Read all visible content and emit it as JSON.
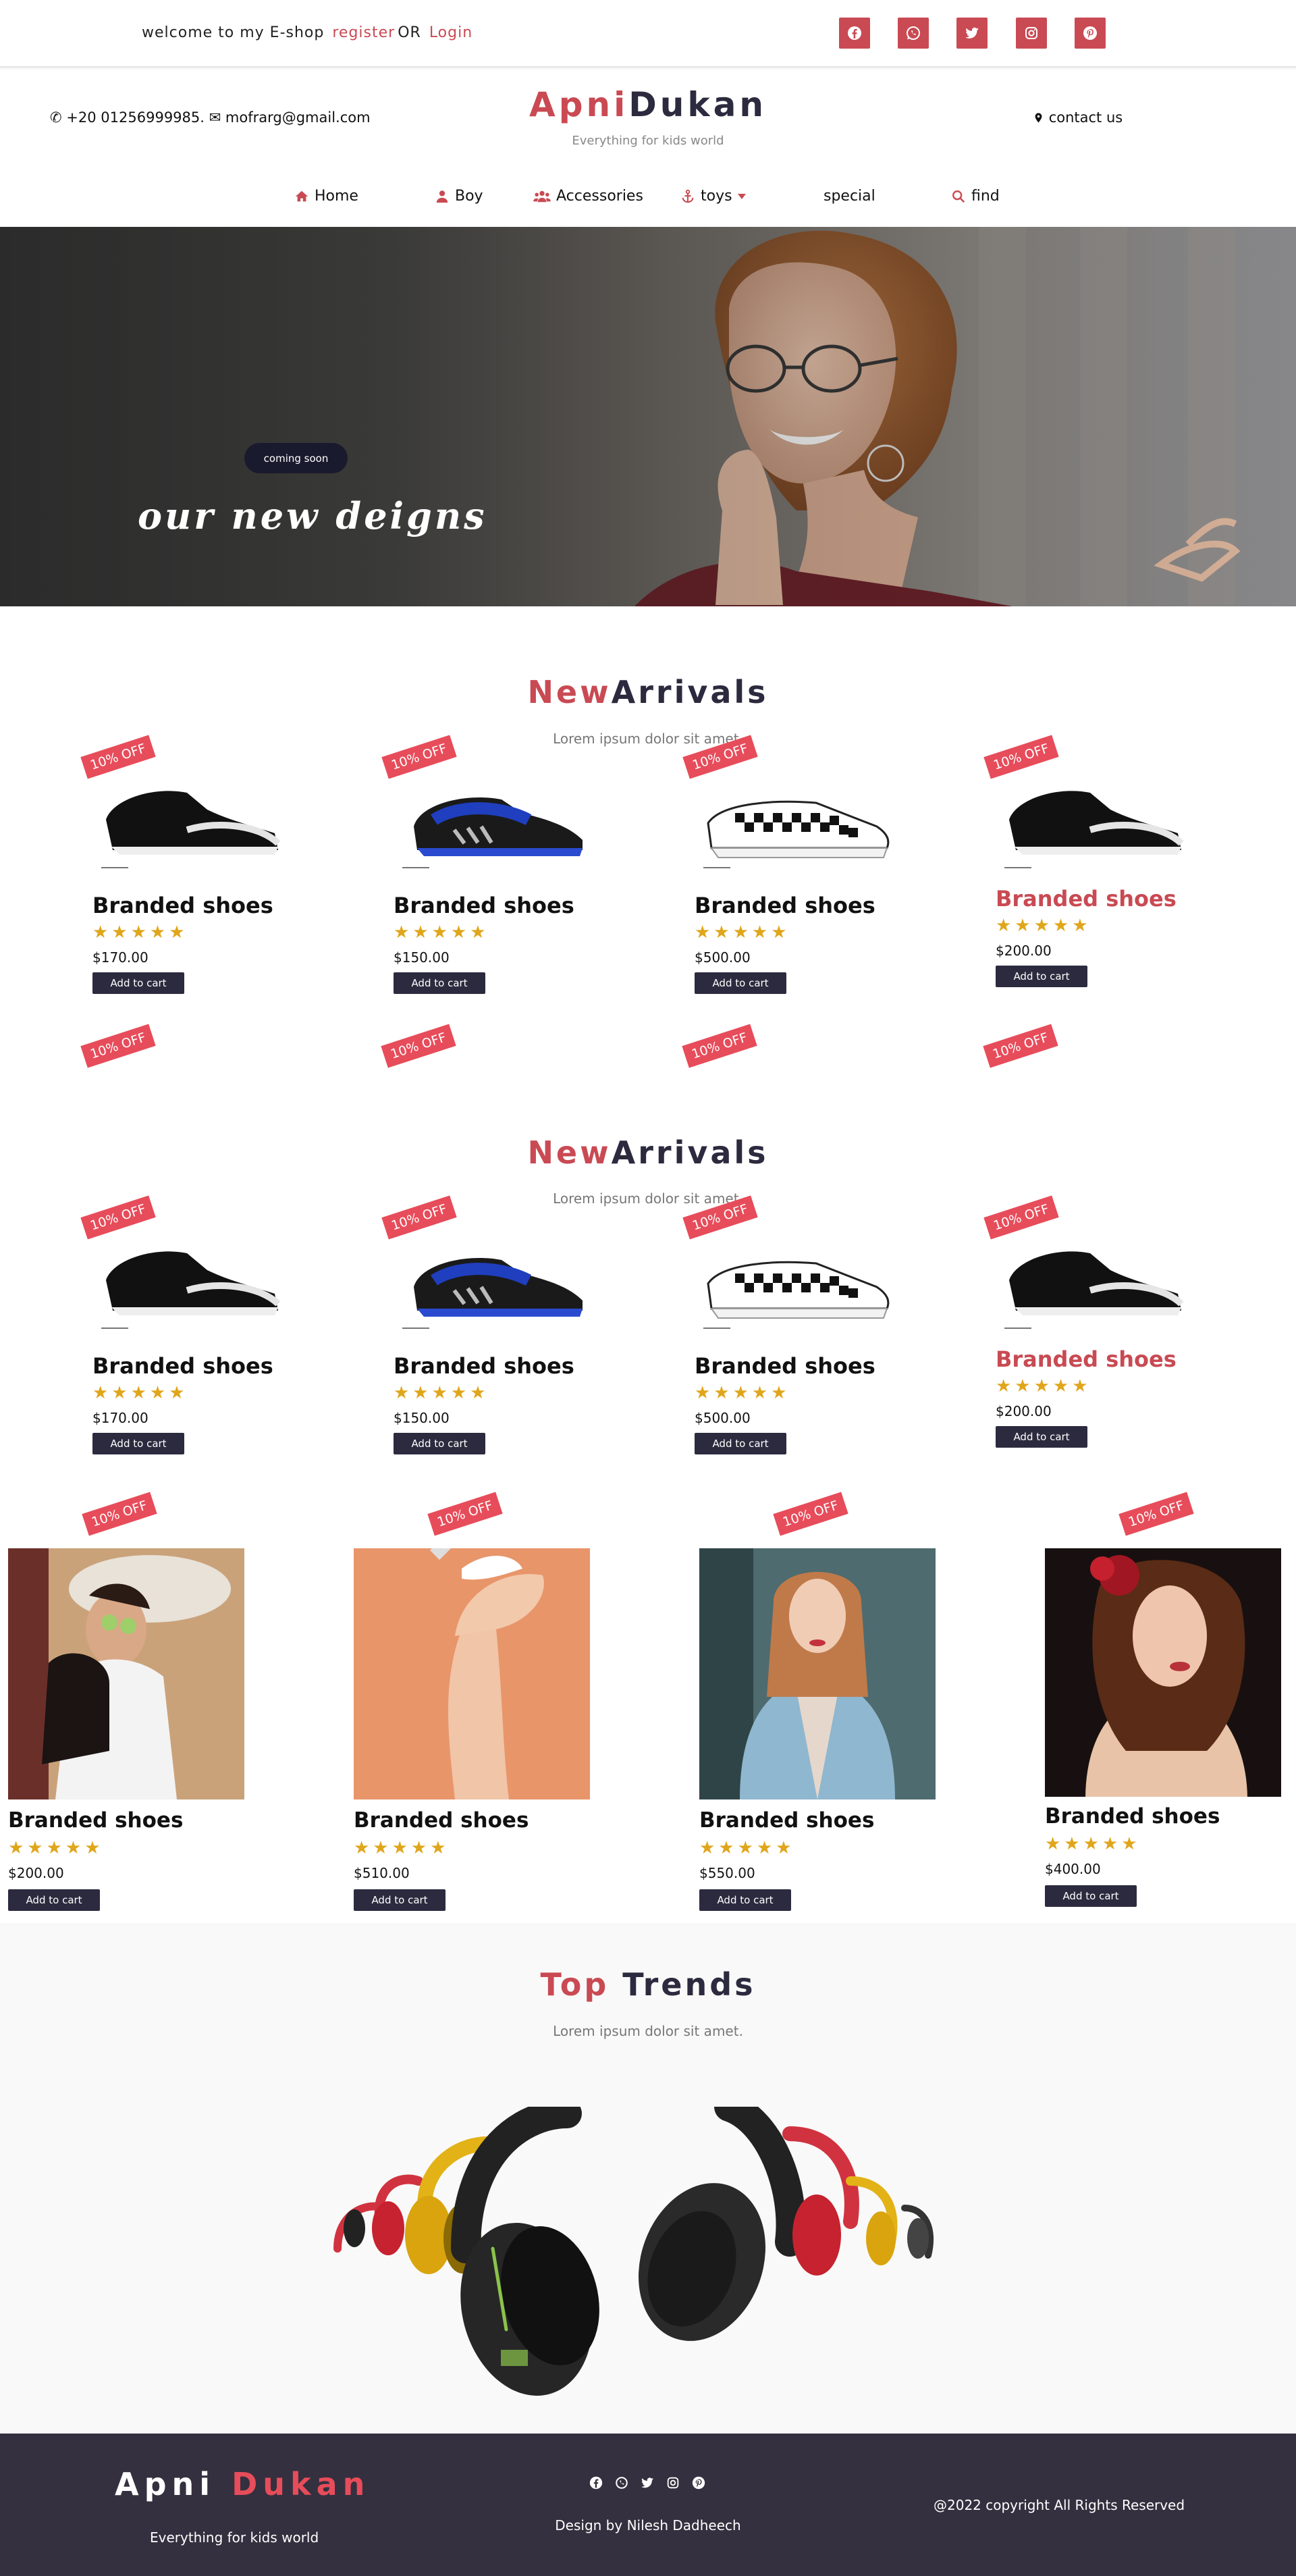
{
  "topbar": {
    "welcome": "welcome to my E-shop",
    "register": "register",
    "or": "OR",
    "login": "Login",
    "social": [
      "facebook-icon",
      "whatsapp-icon",
      "twitter-icon",
      "instagram-icon",
      "pinterest-icon"
    ]
  },
  "header": {
    "phone": "+20 01256999985.",
    "email": "mofrarg@gmail.com",
    "brand_a": "Apni",
    "brand_b": "Dukan",
    "tagline": "Everything for kids world",
    "contact": "contact us"
  },
  "nav": {
    "home": "Home",
    "boy": "Boy",
    "accessories": "Accessories",
    "toys": "toys",
    "special": "special",
    "find": "find"
  },
  "hero": {
    "badge": "coming soon",
    "title": "our new deigns"
  },
  "arrivals1": {
    "title_a": "New",
    "title_b": "Arrivals",
    "subtitle": "Lorem ipsum dolor sit amet."
  },
  "arrivals2": {
    "title_a": "New",
    "title_b": "Arrivals",
    "subtitle": "Lorem ipsum dolor sit amet."
  },
  "products": [
    {
      "badge": "10% OFF",
      "name": "Branded shoes",
      "price": "$170.00",
      "button": "Add to cart",
      "rating": 5
    },
    {
      "badge": "10% OFF",
      "name": "Branded shoes",
      "price": "$150.00",
      "button": "Add to cart",
      "rating": 5
    },
    {
      "badge": "10% OFF",
      "name": "Branded shoes",
      "price": "$500.00",
      "button": "Add to cart",
      "rating": 5
    },
    {
      "badge": "10% OFF",
      "name": "Branded shoes",
      "price": "$200.00",
      "button": "Add to cart",
      "rating": 5
    }
  ],
  "products2": [
    {
      "badge": "10% OFF",
      "name": "Branded shoes",
      "price": "$170.00",
      "button": "Add to cart",
      "rating": 5
    },
    {
      "badge": "10% OFF",
      "name": "Branded shoes",
      "price": "$150.00",
      "button": "Add to cart",
      "rating": 5
    },
    {
      "badge": "10% OFF",
      "name": "Branded shoes",
      "price": "$500.00",
      "button": "Add to cart",
      "rating": 5
    },
    {
      "badge": "10% OFF",
      "name": "Branded shoes",
      "price": "$200.00",
      "button": "Add to cart",
      "rating": 5
    }
  ],
  "photos": [
    {
      "badge": "10% OFF",
      "name": "Branded shoes",
      "price": "$200.00",
      "button": "Add to cart",
      "rating": 5
    },
    {
      "badge": "10% OFF",
      "name": "Branded shoes",
      "price": "$510.00",
      "button": "Add to cart",
      "rating": 5
    },
    {
      "badge": "10% OFF",
      "name": "Branded shoes",
      "price": "$550.00",
      "button": "Add to cart",
      "rating": 5
    },
    {
      "badge": "10% OFF",
      "name": "Branded shoes",
      "price": "$400.00",
      "button": "Add to cart",
      "rating": 5
    }
  ],
  "overflow_badges": [
    "10% OFF",
    "10% OFF",
    "10% OFF",
    "10% OFF"
  ],
  "trends": {
    "title_a": "Top",
    "title_b": "Trends",
    "subtitle": "Lorem ipsum dolor sit amet."
  },
  "footer": {
    "brand_a": "Apni",
    "brand_b": "Dukan",
    "tagline": "Everything for kids world",
    "design": "Design by Nilesh Dadheech",
    "copyright": "@2022 copyright All Rights Reserved"
  },
  "colors": {
    "accent": "#c94a53",
    "dark": "#2c2a3e",
    "badge": "#e74c5a",
    "star": "#e0a61b",
    "footer": "#34303f"
  }
}
